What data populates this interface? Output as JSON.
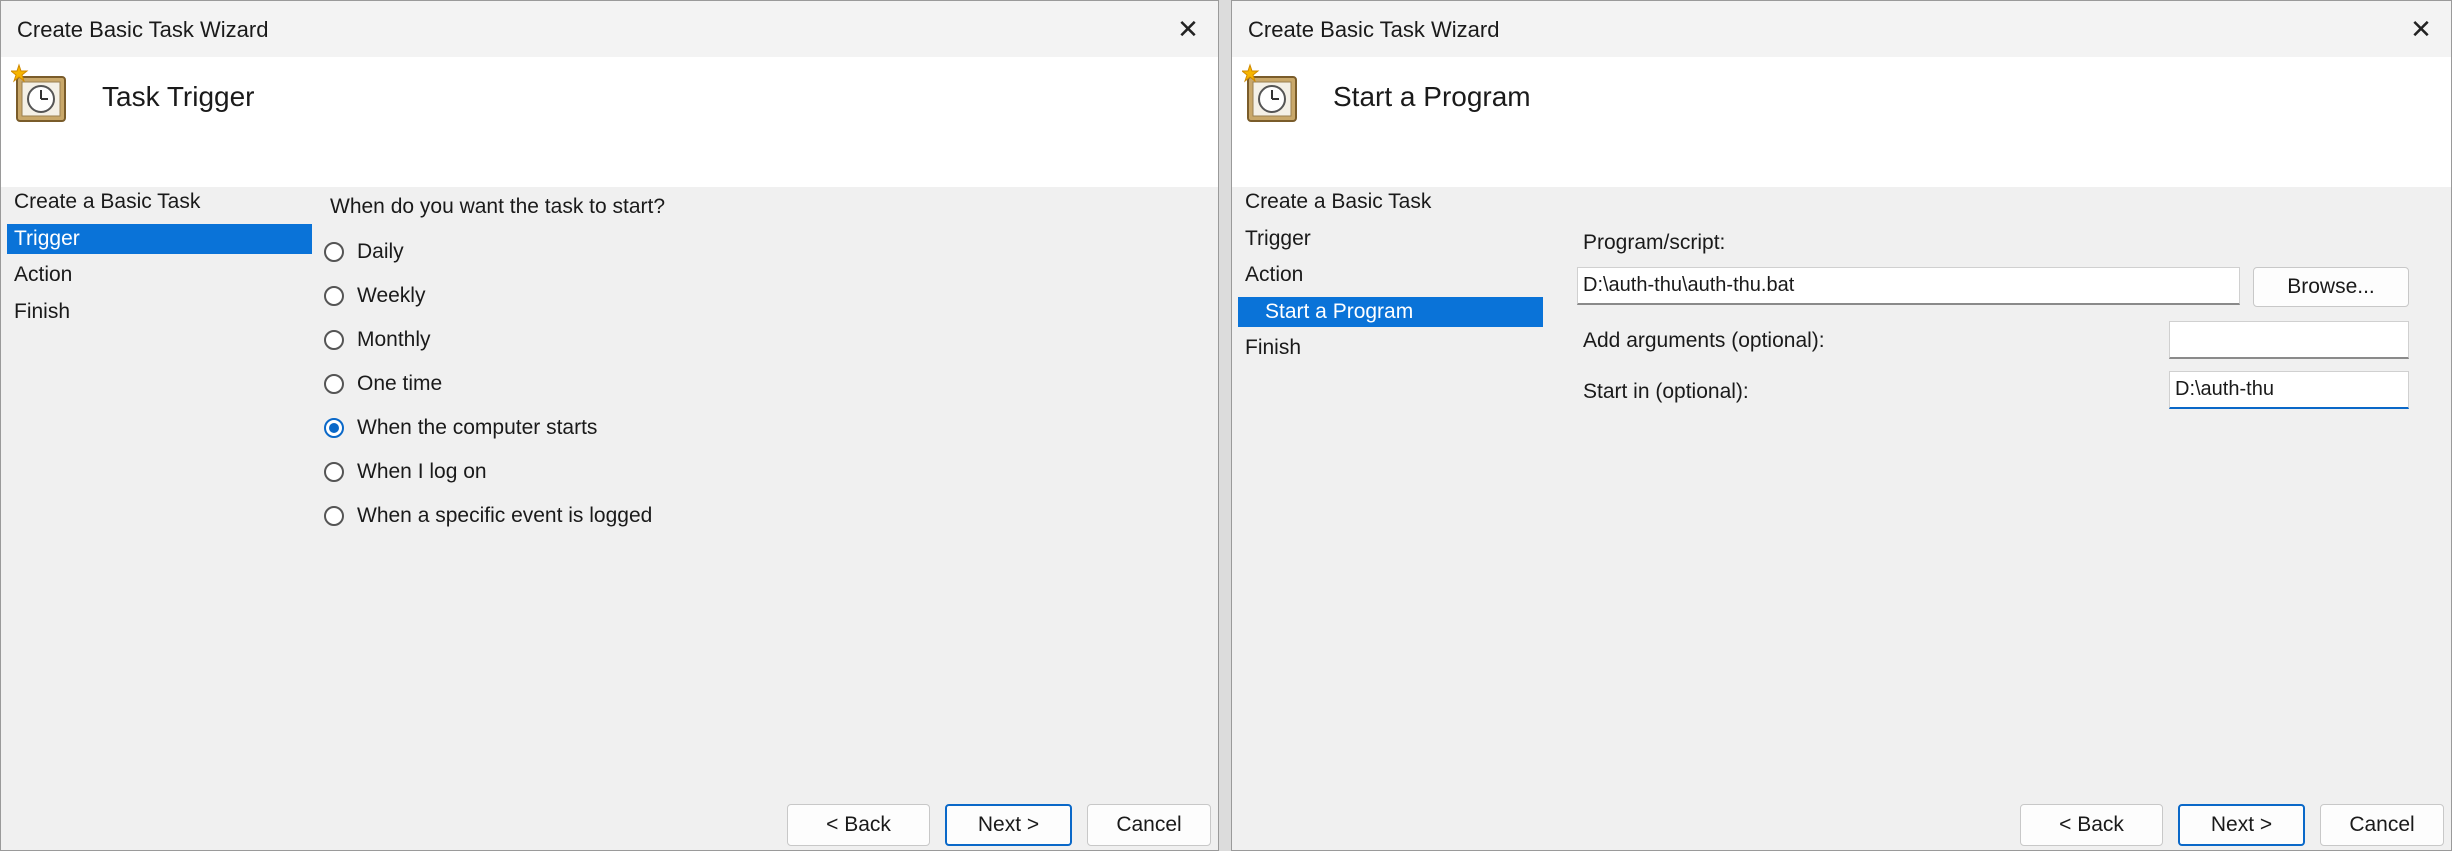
{
  "left_window": {
    "title": "Create Basic Task Wizard",
    "close_glyph": "✕",
    "heading": "Task Trigger",
    "nav": [
      "Create a Basic Task",
      "Trigger",
      "Action",
      "Finish"
    ],
    "question": "When do you want the task to start?",
    "options": [
      {
        "label": "Daily",
        "checked": false
      },
      {
        "label": "Weekly",
        "checked": false
      },
      {
        "label": "Monthly",
        "checked": false
      },
      {
        "label": "One time",
        "checked": false
      },
      {
        "label": "When the computer starts",
        "checked": true
      },
      {
        "label": "When I log on",
        "checked": false
      },
      {
        "label": "When a specific event is logged",
        "checked": false
      }
    ],
    "buttons": {
      "back": "< Back",
      "next": "Next >",
      "cancel": "Cancel"
    }
  },
  "right_window": {
    "title": "Create Basic Task Wizard",
    "close_glyph": "✕",
    "heading": "Start a Program",
    "nav": [
      "Create a Basic Task",
      "Trigger",
      "Action",
      "Start a Program",
      "Finish"
    ],
    "program_label": "Program/script:",
    "program_value": "D:\\auth-thu\\auth-thu.bat",
    "browse_label": "Browse...",
    "args_label": "Add arguments (optional):",
    "args_value": "",
    "startin_label": "Start in (optional):",
    "startin_value": "D:\\auth-thu",
    "buttons": {
      "back": "< Back",
      "next": "Next >",
      "cancel": "Cancel"
    }
  },
  "colors": {
    "selection": "#0a73d8",
    "accent": "#0a68c8"
  }
}
